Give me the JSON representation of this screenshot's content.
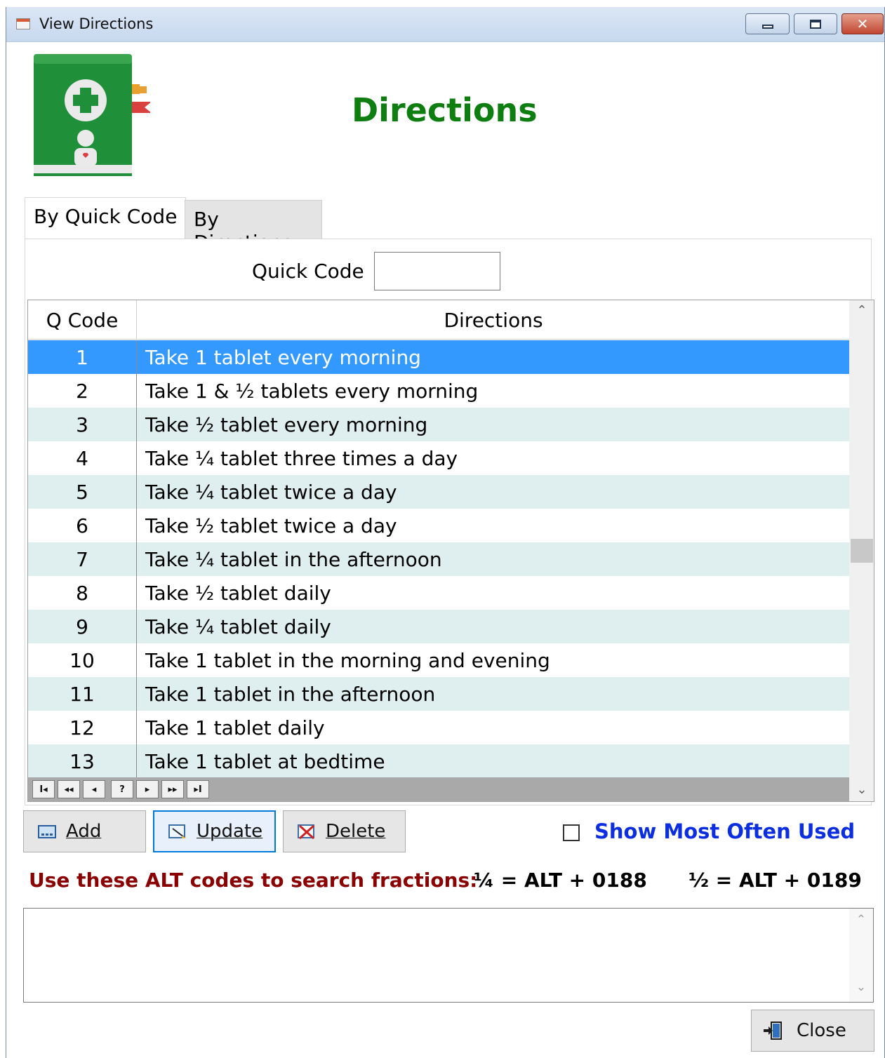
{
  "window": {
    "title": "View Directions",
    "controls": {
      "minimize": "minimize-icon",
      "maximize": "maximize-icon",
      "close": "✕"
    }
  },
  "header": {
    "title": "Directions"
  },
  "tabs": [
    {
      "label": "By Quick Code",
      "active": true
    },
    {
      "label": "By Directions",
      "active": false
    }
  ],
  "search": {
    "label": "Quick Code",
    "value": ""
  },
  "grid": {
    "columns": [
      "Q Code",
      "Directions"
    ],
    "selected_code": "1",
    "rows": [
      {
        "code": "1",
        "direction": "Take 1 tablet every morning"
      },
      {
        "code": "2",
        "direction": "Take 1 & ½ tablets every morning"
      },
      {
        "code": "3",
        "direction": "Take ½ tablet every morning"
      },
      {
        "code": "4",
        "direction": "Take ¼ tablet three times a day"
      },
      {
        "code": "5",
        "direction": "Take ¼ tablet twice a day"
      },
      {
        "code": "6",
        "direction": "Take ½ tablet twice a day"
      },
      {
        "code": "7",
        "direction": "Take ¼ tablet in the afternoon"
      },
      {
        "code": "8",
        "direction": "Take ½ tablet daily"
      },
      {
        "code": "9",
        "direction": "Take ¼ tablet daily"
      },
      {
        "code": "10",
        "direction": "Take 1 tablet in the morning and evening"
      },
      {
        "code": "11",
        "direction": "Take 1 tablet in the afternoon"
      },
      {
        "code": "12",
        "direction": "Take 1 tablet daily"
      },
      {
        "code": "13",
        "direction": "Take 1 tablet at bedtime"
      }
    ],
    "navigator": [
      "I◂",
      "◂◂",
      "◂",
      "?",
      "▸",
      "▸▸",
      "▸I"
    ]
  },
  "actions": {
    "add": "Add",
    "update": "Update",
    "delete": "Delete",
    "show_most_used": "Show Most Often Used",
    "show_most_used_checked": false
  },
  "alt_codes": {
    "note": "Use these ALT codes to search fractions:",
    "quarter": "¼ = ALT + 0188",
    "half": "½ = ALT + 0189"
  },
  "notes": {
    "value": ""
  },
  "footer": {
    "close": "Close"
  },
  "colors": {
    "heading": "#0e7e10",
    "selection": "#3399ff",
    "row_alt": "#dfeeee",
    "link": "#0b2fe0",
    "alt_note": "#8b0000"
  }
}
